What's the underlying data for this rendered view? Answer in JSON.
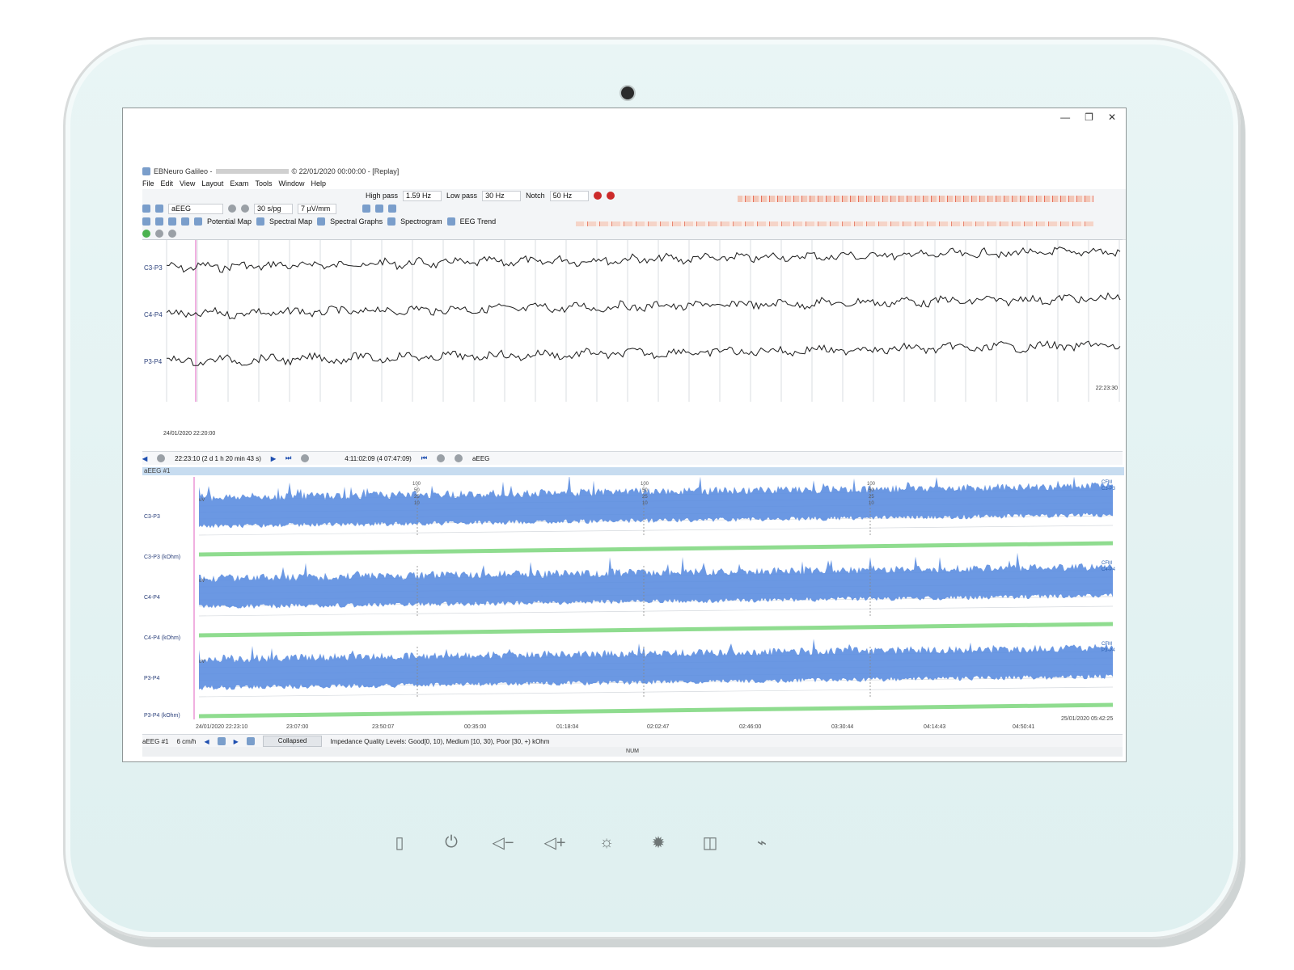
{
  "window": {
    "app_name": "EBNeuro Galileo -",
    "recording_info": "© 22/01/2020 00:00:00 - [Replay]",
    "minimize": "—",
    "restore": "❐",
    "close": "✕"
  },
  "menu": [
    "File",
    "Edit",
    "View",
    "Layout",
    "Exam",
    "Tools",
    "Window",
    "Help"
  ],
  "toolbar1": {
    "high_pass_label": "High pass",
    "high_pass_value": "1.59 Hz",
    "low_pass_label": "Low pass",
    "low_pass_value": "30 Hz",
    "notch_label": "Notch",
    "notch_value": "50 Hz"
  },
  "toolbar2": {
    "montage": "aEEG",
    "speed": "30 s/pg",
    "sensitivity": "7 µV/mm",
    "potential_map": "Potential Map",
    "spectral_map": "Spectral Map",
    "spectral_graphs": "Spectral Graphs",
    "spectrogram": "Spectrogram",
    "eeg_trend": "EEG Trend"
  },
  "eeg": {
    "channels": [
      "C3-P3",
      "C4-P4",
      "P3-P4"
    ],
    "start_time": "24/01/2020 22:20:00",
    "end_time": "22:23:30"
  },
  "nav": {
    "position": "22:23:10 (2 d 1 h 20 min 43 s)",
    "duration": "4:11:02:09 (4 07:47:09)",
    "mode": "aEEG"
  },
  "aeeg": {
    "panel_title": "aEEG #1",
    "channels": [
      {
        "label": "C3-P3",
        "impedance": "C3-P3 (kOhm)",
        "cfm": "CFM",
        "cfm_ch": "C3-P3"
      },
      {
        "label": "C4-P4",
        "impedance": "C4-P4 (kOhm)",
        "cfm": "CFM",
        "cfm_ch": "C4-P4"
      },
      {
        "label": "P3-P4",
        "impedance": "P3-P4 (kOhm)",
        "cfm": "CFM",
        "cfm_ch": "P3-P4"
      }
    ],
    "unit": "uV",
    "scale_100": "100",
    "scale_50": "50",
    "scale_25": "25",
    "scale_10": "10",
    "time_axis": [
      "24/01/2020 22:23:10",
      "23:07:00",
      "23:50:07",
      "00:35:00",
      "01:18:04",
      "02:02:47",
      "02:46:00",
      "03:30:44",
      "04:14:43",
      "04:50:41",
      "25/01/2020 05:42:25"
    ]
  },
  "status": {
    "panel": "aEEG #1",
    "scale": "6 cm/h",
    "view_mode": "Collapsed",
    "impedance_text": "Impedance Quality Levels: Good[0, 10), Medium [10, 30), Poor [30, +) kOhm",
    "num": "NUM"
  },
  "colors": {
    "aeeg_blue": "#5b8de0",
    "impedance_green": "#8fdc8f",
    "cursor_pink": "#e060c0"
  }
}
